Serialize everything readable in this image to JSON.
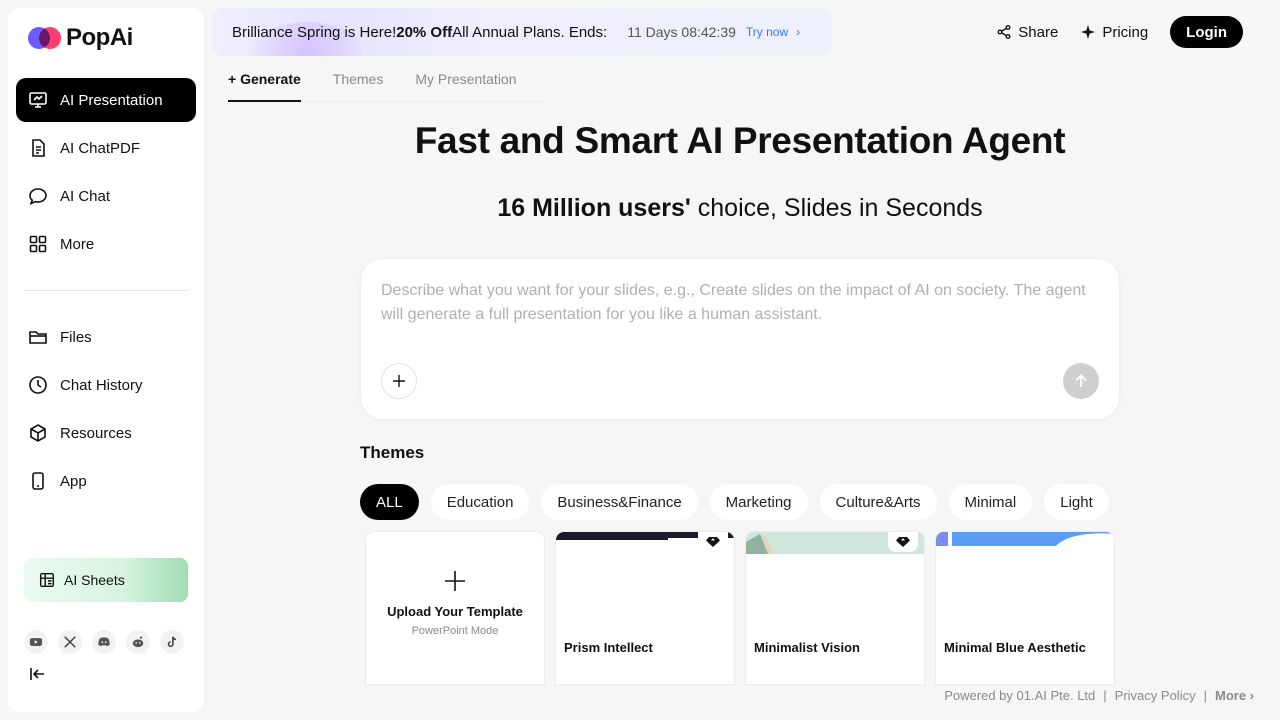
{
  "brand": {
    "name": "PopAi"
  },
  "sidebar": {
    "items": [
      {
        "label": "AI Presentation",
        "icon": "presentation-icon",
        "active": true
      },
      {
        "label": "AI ChatPDF",
        "icon": "document-icon"
      },
      {
        "label": "AI Chat",
        "icon": "chat-icon"
      },
      {
        "label": "More",
        "icon": "grid-icon"
      }
    ],
    "secondary": [
      {
        "label": "Files",
        "icon": "folder-icon"
      },
      {
        "label": "Chat History",
        "icon": "clock-icon"
      },
      {
        "label": "Resources",
        "icon": "box-icon"
      },
      {
        "label": "App",
        "icon": "phone-icon"
      }
    ],
    "sheets_label": "AI Sheets",
    "socials": [
      "youtube-icon",
      "x-icon",
      "discord-icon",
      "reddit-icon",
      "tiktok-icon"
    ]
  },
  "promo": {
    "text_a": "Brilliance Spring is Here! ",
    "discount": "20% Off",
    "text_b": " All Annual Plans. Ends:",
    "countdown": "11 Days 08:42:39",
    "cta": "Try now"
  },
  "header": {
    "share": "Share",
    "pricing": "Pricing",
    "login": "Login"
  },
  "tabs": [
    {
      "label": "+ Generate",
      "active": true
    },
    {
      "label": "Themes"
    },
    {
      "label": "My Presentation"
    }
  ],
  "hero": {
    "title": "Fast and Smart AI Presentation Agent",
    "sub_bold": "16 Million users'",
    "sub_rest": " choice, Slides in Seconds"
  },
  "prompt": {
    "placeholder": "Describe what you want for your slides, e.g., Create slides on the impact of AI on society. The agent will generate a full presentation for you like a human assistant."
  },
  "themes": {
    "title": "Themes",
    "chips": [
      "ALL",
      "Education",
      "Business&Finance",
      "Marketing",
      "Culture&Arts",
      "Minimal",
      "Light"
    ],
    "upload_title": "Upload Your Template",
    "upload_sub": "PowerPoint Mode",
    "cards": [
      {
        "name": "Prism Intellect"
      },
      {
        "name": "Minimalist Vision"
      },
      {
        "name": "Minimal Blue Aesthetic"
      }
    ]
  },
  "footer": {
    "powered": "Powered by 01.AI Pte. Ltd",
    "privacy": "Privacy Policy",
    "more": "More"
  },
  "colors": {
    "accent": "#000000",
    "link": "#2e7cf6"
  }
}
